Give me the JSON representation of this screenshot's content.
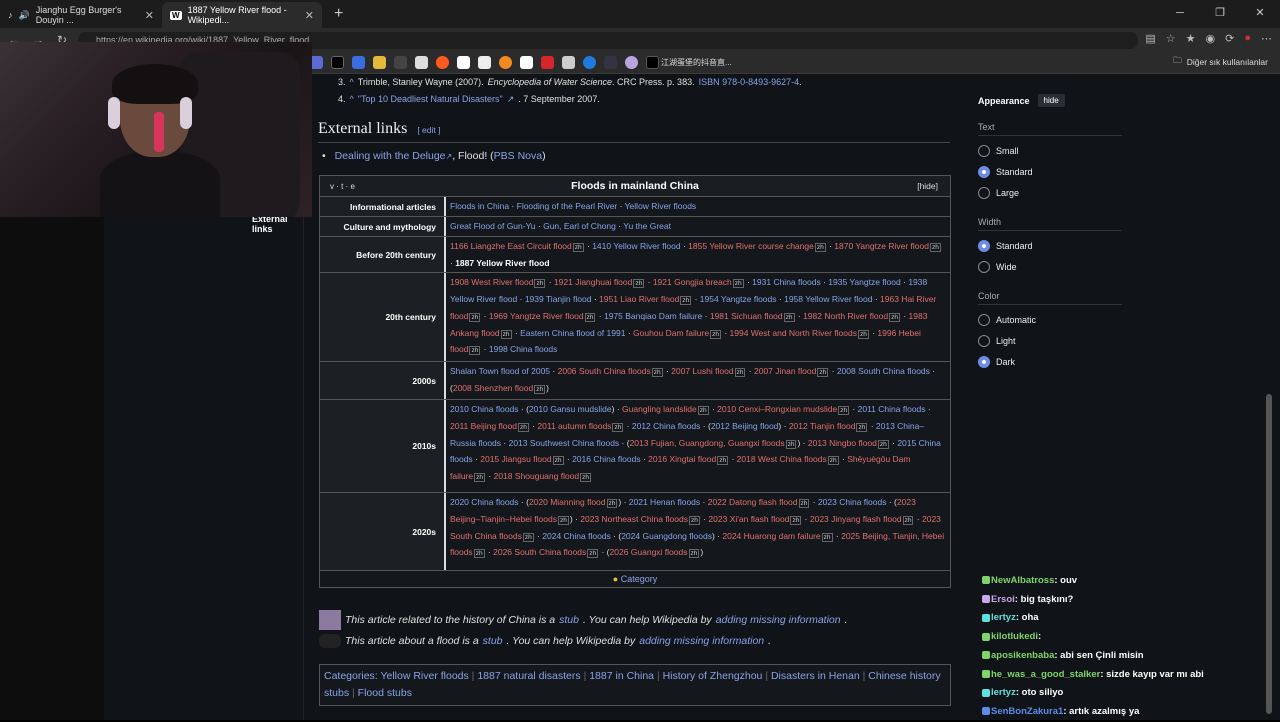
{
  "tabs": [
    {
      "label": "Jianghu Egg Burger's Douyin ..."
    },
    {
      "label": "1887 Yellow River flood - Wikipedi..."
    }
  ],
  "address": {
    "url": "https://en.wikipedia.org/wiki/1887_Yellow_River_flood"
  },
  "bookmarks": {
    "last_label": "江湖蛋堡的抖音直...",
    "other_label": "Diğer sık kullanılanlar"
  },
  "refs": [
    {
      "num": "3.",
      "parts": [
        " Trimble, Stanley Wayne (2007). ",
        "Encyclopedia of Water Science",
        ". CRC Press. p. 383. ",
        "ISBN 978-0-8493-9627-4",
        "."
      ]
    },
    {
      "num": "4.",
      "parts": [
        "\"Top 10 Deadliest Natural Disasters\"",
        ". 7 September 2007."
      ]
    }
  ],
  "external_links": {
    "heading": "External links",
    "edit": "[ edit ]",
    "item_link": "Dealing with the Deluge",
    "item_mid": ", Flood! (",
    "item_link2": "PBS Nova",
    "item_end": ")"
  },
  "sidebar_label": "External links",
  "navbox": {
    "vte": "v · t · e",
    "title": "Floods in mainland China",
    "hide": "[hide]",
    "rows": [
      {
        "group": "Informational articles",
        "items": [
          [
            "Floods in China",
            "b"
          ],
          [
            "Flooding of the Pearl River",
            "b"
          ],
          [
            "Yellow River floods",
            "b"
          ]
        ]
      },
      {
        "group": "Culture and mythology",
        "items": [
          [
            "Great Flood of Gun-Yu",
            "b"
          ],
          [
            "Gun, Earl of Chong",
            "b"
          ],
          [
            "Yu the Great",
            "b"
          ]
        ]
      },
      {
        "group": "Before 20th century",
        "items": [
          [
            "1166 Liangzhe East Circuit flood",
            "r",
            "zh"
          ],
          [
            "1410 Yellow River flood",
            "b"
          ],
          [
            "1855 Yellow River course change",
            "r",
            "zh"
          ],
          [
            "1870 Yangtze River flood",
            "r",
            "zh"
          ],
          [
            "1887 Yellow River flood",
            "w"
          ]
        ]
      },
      {
        "group": "20th century",
        "items": [
          [
            "1908 West River flood",
            "r",
            "zh"
          ],
          [
            "1921 Jianghuai flood",
            "r",
            "zh"
          ],
          [
            "1921 Gongjia breach",
            "r",
            "zh"
          ],
          [
            "1931 China floods",
            "b"
          ],
          [
            "1935 Yangtze flood",
            "b"
          ],
          [
            "1938 Yellow River flood",
            "b"
          ],
          [
            "1939 Tianjin flood",
            "b"
          ],
          [
            "1951 Liao River flood",
            "r",
            "zh"
          ],
          [
            "1954 Yangtze floods",
            "b"
          ],
          [
            "1958 Yellow River flood",
            "b"
          ],
          [
            "1963 Hai River flood",
            "r",
            "zh"
          ],
          [
            "1969 Yangtze River flood",
            "r",
            "zh"
          ],
          [
            "1975 Banqiao Dam failure",
            "b"
          ],
          [
            "1981 Sichuan flood",
            "r",
            "zh"
          ],
          [
            "1982 North River flood",
            "r",
            "zh"
          ],
          [
            "1983 Ankang flood",
            "r",
            "zh"
          ],
          [
            "Eastern China flood of 1991",
            "b"
          ],
          [
            "Gouhou Dam failure",
            "r",
            "zh"
          ],
          [
            "1994 West and North River floods",
            "r",
            "zh"
          ],
          [
            "1996 Hebei flood",
            "r",
            "zh"
          ],
          [
            "1998 China floods",
            "b"
          ]
        ]
      },
      {
        "group": "2000s",
        "items": [
          [
            "Shalan Town flood of 2005",
            "b"
          ],
          [
            "2006 South China floods",
            "r",
            "zh"
          ],
          [
            "2007 Lushi flood",
            "r",
            "zh"
          ],
          [
            "2007 Jinan flood",
            "r",
            "zh"
          ],
          [
            "2008 South China floods",
            "b"
          ],
          [
            "2008 Shenzhen flood",
            "r",
            "zh",
            "("
          ]
        ]
      },
      {
        "group": "2010s",
        "items": [
          [
            "2010 China floods",
            "b"
          ],
          [
            "2010 Gansu mudslide",
            "b",
            "",
            "("
          ],
          [
            "Guangling landslide",
            "r",
            "zh"
          ],
          [
            "2010 Cenxi–Rongxian mudslide",
            "r",
            "zh"
          ],
          [
            "2011 China floods",
            "b"
          ],
          [
            "2011 Beijing flood",
            "r",
            "zh"
          ],
          [
            "2011 autumn floods",
            "r",
            "zh"
          ],
          [
            "2012 China floods",
            "b"
          ],
          [
            "2012 Beijing flood",
            "b",
            "",
            "("
          ],
          [
            "2012 Tianjin flood",
            "r",
            "zh"
          ],
          [
            "2013 China–Russia floods",
            "b"
          ],
          [
            "2013 Southwest China floods",
            "b"
          ],
          [
            "2013 Fujian, Guangdong, Guangxi floods",
            "r",
            "zh",
            "("
          ],
          [
            "2013 Ningbo flood",
            "r",
            "zh"
          ],
          [
            "2015 China floods",
            "b"
          ],
          [
            "2015 Jiangsu flood",
            "r",
            "zh"
          ],
          [
            "2016 China floods",
            "b"
          ],
          [
            "2016 Xingtai flood",
            "r",
            "zh"
          ],
          [
            "2018 West China floods",
            "r",
            "zh"
          ],
          [
            "Shēyuègōu Dam failure",
            "r",
            "zh"
          ],
          [
            "2018 Shouguang flood",
            "r",
            "zh"
          ]
        ]
      },
      {
        "group": "2020s",
        "items": [
          [
            "2020 China floods",
            "b"
          ],
          [
            "2020 Mianning flood",
            "r",
            "zh",
            "("
          ],
          [
            "2021 Henan floods",
            "b"
          ],
          [
            "2022 Datong flash flood",
            "r",
            "zh"
          ],
          [
            "2023 China floods",
            "b"
          ],
          [
            "2023 Beijing–Tianjin–Hebei floods",
            "r",
            "zh",
            "("
          ],
          [
            "2023 Northeast China floods",
            "r",
            "zh"
          ],
          [
            "2023 Xi'an flash flood",
            "r",
            "zh"
          ],
          [
            "2023 Jinyang flash flood",
            "r",
            "zh"
          ],
          [
            "2023 South China floods",
            "r",
            "zh"
          ],
          [
            "2024 China floods",
            "b"
          ],
          [
            "2024 Guangdong floods",
            "b",
            "",
            "("
          ],
          [
            "2024 Huarong dam failure",
            "r",
            "zh"
          ],
          [
            "2025 Beijing, Tianjin, Hebei floods",
            "r",
            "zh"
          ],
          [
            "2026 South China floods",
            "r",
            "zh"
          ],
          [
            "2026 Guangxi floods",
            "r",
            "zh",
            "("
          ]
        ]
      }
    ],
    "category": "Category"
  },
  "stubs": [
    {
      "pre": "This article related to the history of China is a ",
      "link": "stub",
      "mid": ". You can help Wikipedia by ",
      "link2": "adding missing information",
      "end": "."
    },
    {
      "pre": "This article about a flood is a ",
      "link": "stub",
      "mid": ". You can help Wikipedia by ",
      "link2": "adding missing information",
      "end": "."
    }
  ],
  "categories": {
    "label": "Categories:",
    "items": [
      "Yellow River floods",
      "1887 natural disasters",
      "1887 in China",
      "History of Zhengzhou",
      "Disasters in Henan",
      "Chinese history stubs",
      "Flood stubs"
    ]
  },
  "appearance": {
    "title": "Appearance",
    "hide": "hide",
    "text_label": "Text",
    "text_opts": [
      "Small",
      "Standard",
      "Large"
    ],
    "text_sel": 1,
    "width_label": "Width",
    "width_opts": [
      "Standard",
      "Wide"
    ],
    "width_sel": 0,
    "color_label": "Color",
    "color_opts": [
      "Automatic",
      "Light",
      "Dark"
    ],
    "color_sel": 2
  },
  "chat": [
    {
      "user": "NewAlbatross",
      "color": "#7fd46a",
      "msg": "ouv"
    },
    {
      "user": "Ersoi",
      "color": "#c9a7e8",
      "msg": "big  taşkını?"
    },
    {
      "user": "lertyz",
      "color": "#5fe0e0",
      "msg": "oha"
    },
    {
      "user": "kilotlukedi",
      "color": "#7fd46a",
      "msg": ""
    },
    {
      "user": "aposikenbaba",
      "color": "#7fd46a",
      "msg": "abi sen Çinli misin"
    },
    {
      "user": "he_was_a_good_stalker",
      "color": "#7fd46a",
      "msg": "sizde kayıp var mı abi"
    },
    {
      "user": "lertyz",
      "color": "#5fe0e0",
      "msg": "oto siliyo"
    },
    {
      "user": "SenBonZakura1",
      "color": "#5f8ae8",
      "msg": "artık azalmış ya"
    }
  ]
}
